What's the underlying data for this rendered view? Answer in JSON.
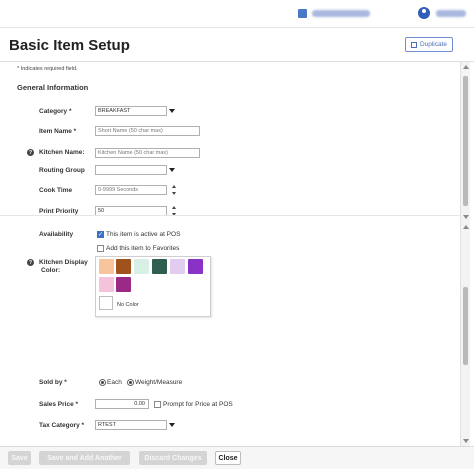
{
  "topbar": {
    "store_icon": "store-icon",
    "user_icon": "user-avatar-icon"
  },
  "header": {
    "title": "Basic Item Setup",
    "duplicate_label": "Duplicate"
  },
  "form": {
    "required_note": "* Indicates required field.",
    "section_title": "General Information",
    "category": {
      "label": "Category *",
      "value": "BREAKFAST"
    },
    "item_name": {
      "label": "Item Name *",
      "placeholder": "Short Name (50 char max)"
    },
    "kitchen_name": {
      "label": "Kitchen Name:",
      "placeholder": "Kitchen Name (50 char max)"
    },
    "routing_group": {
      "label": "Routing Group",
      "value": ""
    },
    "cook_time": {
      "label": "Cook Time",
      "placeholder": "0-9999 Seconds"
    },
    "print_priority": {
      "label": "Print Priority",
      "value": "50"
    },
    "availability": {
      "label": "Availability",
      "active_label": "This item is active at POS",
      "active_checked": true,
      "favorites_label": "Add this item to Favorites",
      "favorites_checked": false
    },
    "kitchen_display_color": {
      "label_line1": "Kitchen Display",
      "label_line2": "Color:",
      "swatches": [
        "#f7c49b",
        "#a0521d",
        "#d8efe6",
        "#2f5e51",
        "#e2cdf0",
        "#8a32c8",
        "#f5c2dc",
        "#9a2a86"
      ],
      "no_color_label": "No Color"
    },
    "sold_by": {
      "label": "Sold by *",
      "option_each": "Each",
      "option_weight": "Weight/Measure"
    },
    "sales_price": {
      "label": "Sales Price *",
      "value": "0.00",
      "prompt_label": "Prompt for Price at POS"
    },
    "tax_category": {
      "label": "Tax Category *",
      "value": "RTEST"
    }
  },
  "footer": {
    "save_label": "Save",
    "save_add_label": "Save and Add Another",
    "discard_label": "Discard Changes",
    "close_label": "Close"
  }
}
